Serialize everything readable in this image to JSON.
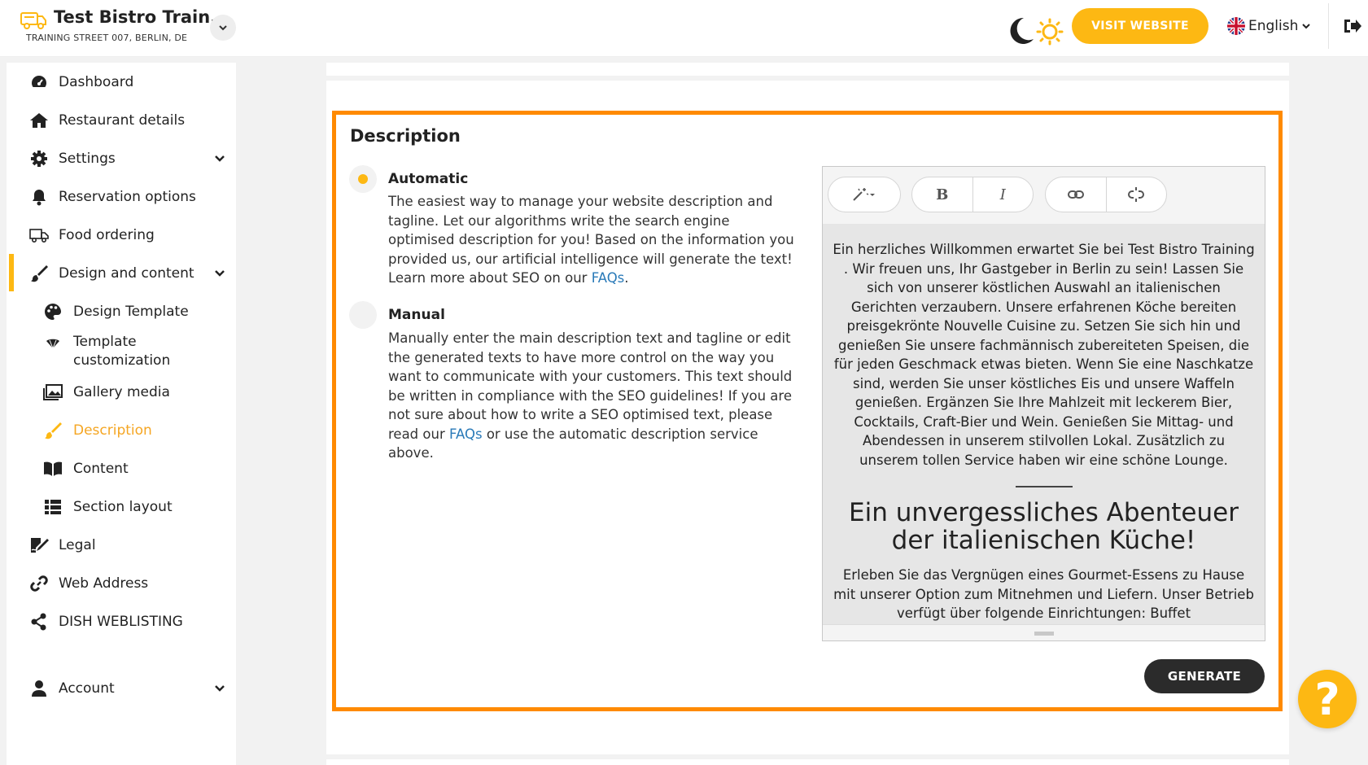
{
  "header": {
    "restaurant_name": "Test Bistro Train...",
    "address": "TRAINING STREET 007, BERLIN, DE",
    "visit_website_label": "VISIT WEBSITE",
    "language": "English",
    "accent_color": "#fdb813"
  },
  "sidebar": {
    "items": [
      {
        "label": "Dashboard",
        "icon": "dashboard-icon"
      },
      {
        "label": "Restaurant details",
        "icon": "home-icon"
      },
      {
        "label": "Settings",
        "icon": "gear-icon"
      },
      {
        "label": "Reservation options",
        "icon": "bell-icon"
      },
      {
        "label": "Food ordering",
        "icon": "food-ordering-icon"
      },
      {
        "label": "Design and content",
        "icon": "brush-icon"
      },
      {
        "label": "Design Template",
        "icon": "palette-icon"
      },
      {
        "label": "Template",
        "icon": "fan-icon"
      },
      {
        "label": "customization",
        "icon": ""
      },
      {
        "label": "Gallery media",
        "icon": "gallery-icon"
      },
      {
        "label": "Description",
        "icon": "brush-icon"
      },
      {
        "label": "Content",
        "icon": "book-icon"
      },
      {
        "label": "Section layout",
        "icon": "list-icon"
      },
      {
        "label": "Legal",
        "icon": "signature-icon"
      },
      {
        "label": "Web Address",
        "icon": "link-icon"
      },
      {
        "label": "DISH WEBLISTING",
        "icon": "share-icon"
      },
      {
        "label": "Account",
        "icon": "user-icon"
      }
    ]
  },
  "description_section": {
    "title": "Description",
    "automatic": {
      "title": "Automatic",
      "text": "The easiest way to manage your website description and tagline. Let our algorithms write the search engine optimised description for you! Based on the information you provided us, our artificial intelligence will generate the text! Learn more about SEO on our",
      "link": "FAQs",
      "suffix": "."
    },
    "manual": {
      "title": "Manual",
      "text_before": "Manually enter the main description text and tagline or edit the generated texts to have more control on the way you want to communicate with your customers. This text should be written in compliance with the SEO guidelines! If you are not sure about how to write a SEO optimised text, please read our",
      "link": "FAQs",
      "text_after": "or use the automatic description service above."
    },
    "editor": {
      "toolbar": {
        "bold": "B",
        "italic": "I"
      },
      "paragraph1": "Ein herzliches Willkommen erwartet Sie bei Test Bistro Training . Wir freuen uns, Ihr Gastgeber in Berlin zu sein! Lassen Sie sich von unserer köstlichen Auswahl an italienischen Gerichten verzaubern. Unsere erfahrenen Köche bereiten preisgekrönte Nouvelle Cuisine zu. Setzen Sie sich hin und genießen Sie unsere fachmännisch zubereiteten Speisen, die für jeden Geschmack etwas bieten. Wenn Sie eine Naschkatze sind, werden Sie unser köstliches Eis und unsere Waffeln genießen. Ergänzen Sie Ihre Mahlzeit mit leckerem Bier, Cocktails, Craft-Bier und Wein. Genießen Sie Mittag- und Abendessen in unserem stilvollen Lokal. Zusätzlich zu unserem tollen Service haben wir eine schöne Lounge.",
      "heading": "Ein unvergessliches Abenteuer der italienischen Küche!",
      "paragraph2": "Erleben Sie das Vergnügen eines Gourmet-Essens zu Hause mit unserer Option zum Mitnehmen und Liefern. Unser Betrieb verfügt über folgende Einrichtungen: Buffet"
    },
    "generate_label": "GENERATE"
  },
  "help_label": "?"
}
